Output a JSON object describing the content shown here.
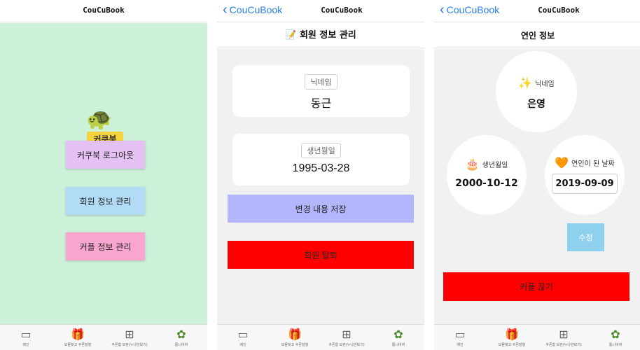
{
  "app_title": "CouCuBook",
  "back_label": "CouCuBook",
  "tabs": [
    {
      "label": "메인",
      "icon": "easel-icon"
    },
    {
      "label": "보물찾고 쿠폰발행",
      "icon": "gift-icon"
    },
    {
      "label": "쿠폰함 보관(누나만보기)",
      "icon": "add-box-icon"
    },
    {
      "label": "톱니바퀴",
      "icon": "flower-icon"
    }
  ],
  "screen1": {
    "logo_text": "커쿠북",
    "buttons": {
      "logout": "커쿠북 로그아웃",
      "member_info": "회원 정보 관리",
      "couple_info": "커플 정보 관리"
    },
    "colors": {
      "background": "#cdf0d8",
      "logout": "#e4c1f2",
      "member_info": "#b2dcf6",
      "couple_info": "#f8a6cf"
    }
  },
  "screen2": {
    "title_emoji": "📝",
    "title": "회원 정보 관리",
    "nickname_label": "닉네임",
    "nickname_value": "동근",
    "birth_label": "생년월일",
    "birth_value": "1995-03-28",
    "save_button": "변경 내용 저장",
    "withdraw_button": "회원 탈퇴"
  },
  "screen3": {
    "title": "연인 정보",
    "nickname_emoji": "✨",
    "nickname_label": "닉네임",
    "nickname_value": "은영",
    "birth_emoji": "🎂",
    "birth_label": "생년월일",
    "birth_value": "2000-10-12",
    "anniv_emoji": "🧡",
    "anniv_label": "연인이 된 날짜",
    "anniv_value": "2019-09-09",
    "edit_button": "수정",
    "breakup_button": "커플 끊기"
  }
}
